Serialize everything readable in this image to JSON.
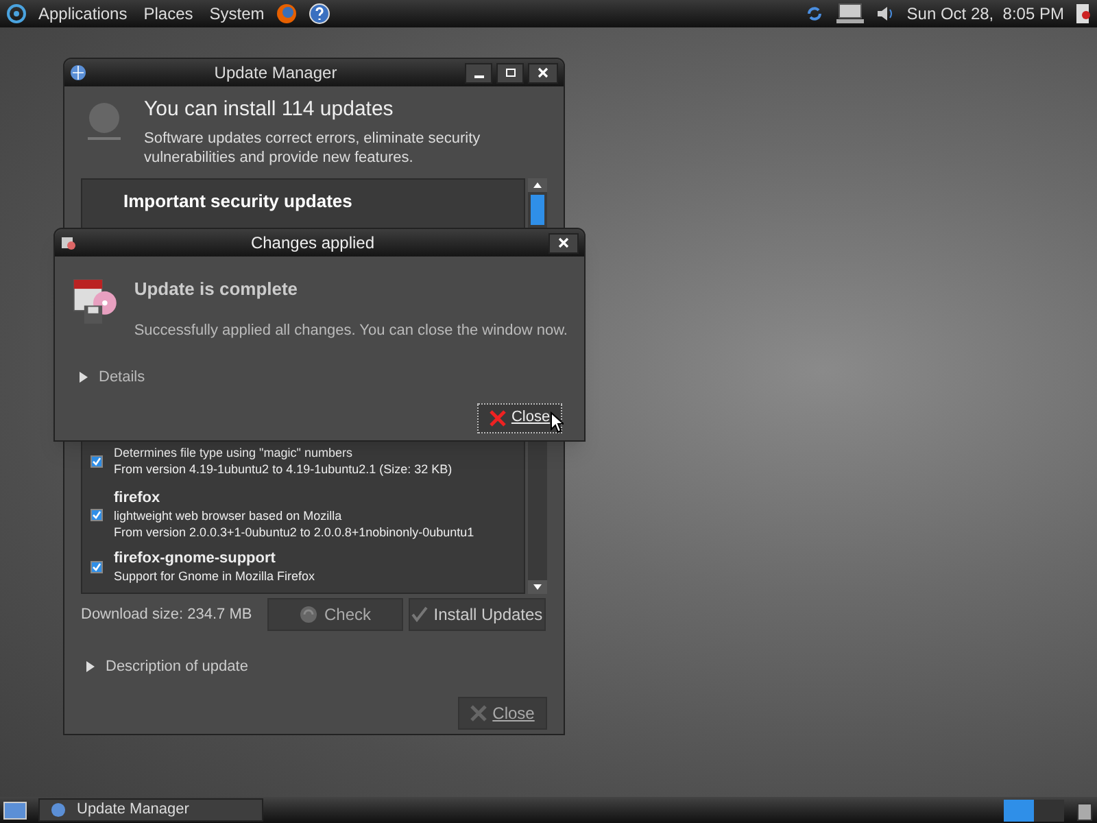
{
  "top_panel": {
    "menus": [
      "Applications",
      "Places",
      "System"
    ],
    "clock": "Sun Oct 28,  8:05 PM"
  },
  "update_manager": {
    "title": "Update Manager",
    "heading": "You can install 114 updates",
    "subtitle": "Software updates correct errors, eliminate security vulnerabilities and provide new features.",
    "section": "Important security updates",
    "packages": [
      {
        "description": "Determines file type using \"magic\" numbers",
        "version": "From version 4.19-1ubuntu2 to 4.19-1ubuntu2.1 (Size: 32 KB)",
        "checked": true
      },
      {
        "name": "firefox",
        "description": "lightweight web browser based on Mozilla",
        "version": "From version 2.0.0.3+1-0ubuntu2 to 2.0.0.8+1nobinonly-0ubuntu1",
        "checked": true
      },
      {
        "name": "firefox-gnome-support",
        "description": "Support for Gnome in Mozilla Firefox",
        "checked": true
      }
    ],
    "download_size": "Download size: 234.7 MB",
    "check_button": "Check",
    "install_button": "Install Updates",
    "description_expander": "Description of update",
    "close_button": "Close"
  },
  "dialog": {
    "title": "Changes applied",
    "heading": "Update is complete",
    "message": "Successfully applied all changes. You can close the window now.",
    "details": "Details",
    "close_button": "Close"
  },
  "taskbar": {
    "tasks": [
      {
        "label": "Update Manager",
        "selected": false
      }
    ]
  }
}
